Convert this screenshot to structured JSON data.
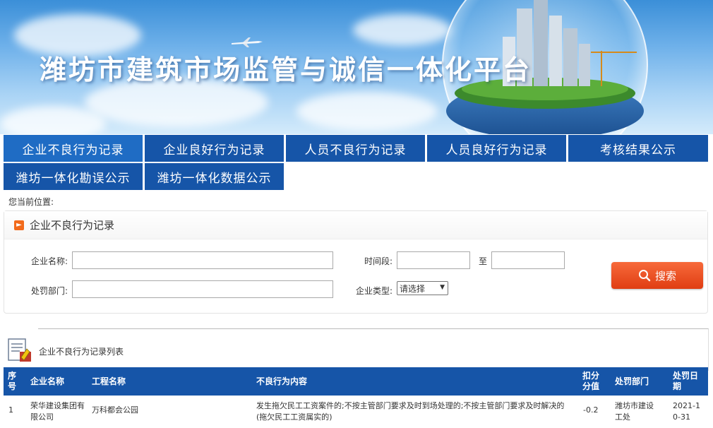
{
  "header": {
    "title": "潍坊市建筑市场监管与诚信一体化平台"
  },
  "nav": {
    "row1": [
      "企业不良行为记录",
      "企业良好行为记录",
      "人员不良行为记录",
      "人员良好行为记录",
      "考核结果公示"
    ],
    "row2": [
      "潍坊一体化勘误公示",
      "潍坊一体化数据公示"
    ],
    "active": "企业不良行为记录"
  },
  "breadcrumb": "您当前位置:",
  "search_panel": {
    "title": "企业不良行为记录",
    "company_name_label": "企业名称:",
    "company_name_value": "",
    "period_label": "时间段:",
    "period_from": "",
    "to_label": "至",
    "period_to": "",
    "dept_label": "处罚部门:",
    "dept_value": "",
    "type_label": "企业类型:",
    "type_selected": "请选择",
    "search_button": "搜索"
  },
  "list": {
    "title": "企业不良行为记录列表",
    "columns": [
      "序号",
      "企业名称",
      "工程名称",
      "不良行为内容",
      "扣分分值",
      "处罚部门",
      "处罚日期"
    ],
    "rows": [
      {
        "index": "1",
        "company": "荣华建设集团有限公司",
        "project": "万科都会公园",
        "content": "发生拖欠民工工资案件的;不按主管部门要求及时到场处理的;不按主管部门要求及时解决的(拖欠民工工资属实的)",
        "score": "-0.2",
        "dept": "潍坊市建设工处",
        "date": "2021-10-31"
      }
    ]
  },
  "colors": {
    "nav_bg": "#1655a8",
    "nav_active": "#1f6cc4",
    "search_button": "#e8481c",
    "table_header": "#1655a8"
  }
}
